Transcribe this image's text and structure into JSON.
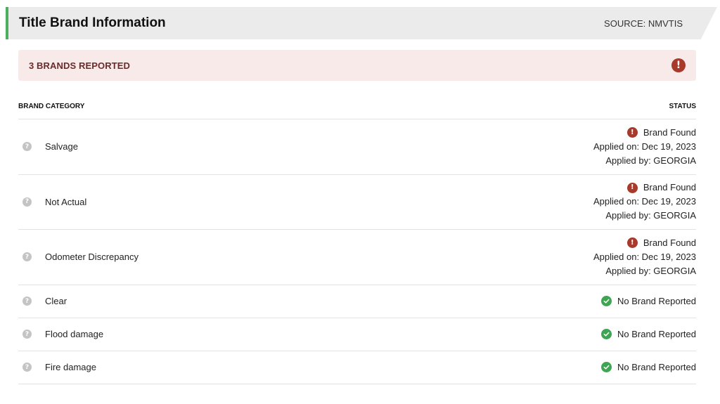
{
  "header": {
    "title": "Title Brand Information",
    "source": "SOURCE: NMVTIS",
    "accent_color": "#4caf5d"
  },
  "alert": {
    "text": "3 BRANDS REPORTED",
    "icon": "exclamation-circle-icon",
    "color": "#a83a2c"
  },
  "table": {
    "columns": [
      "BRAND CATEGORY",
      "STATUS"
    ],
    "rows": [
      {
        "category": "Salvage",
        "status": "Brand Found",
        "applied_on": "Applied on: Dec 19, 2023",
        "applied_by": "Applied by: GEORGIA",
        "found": true
      },
      {
        "category": "Not Actual",
        "status": "Brand Found",
        "applied_on": "Applied on: Dec 19, 2023",
        "applied_by": "Applied by: GEORGIA",
        "found": true
      },
      {
        "category": "Odometer Discrepancy",
        "status": "Brand Found",
        "applied_on": "Applied on: Dec 19, 2023",
        "applied_by": "Applied by: GEORGIA",
        "found": true
      },
      {
        "category": "Clear",
        "status": "No Brand Reported",
        "found": false
      },
      {
        "category": "Flood damage",
        "status": "No Brand Reported",
        "found": false
      },
      {
        "category": "Fire damage",
        "status": "No Brand Reported",
        "found": false
      }
    ]
  },
  "icons": {
    "help": "?",
    "exclamation": "!"
  }
}
